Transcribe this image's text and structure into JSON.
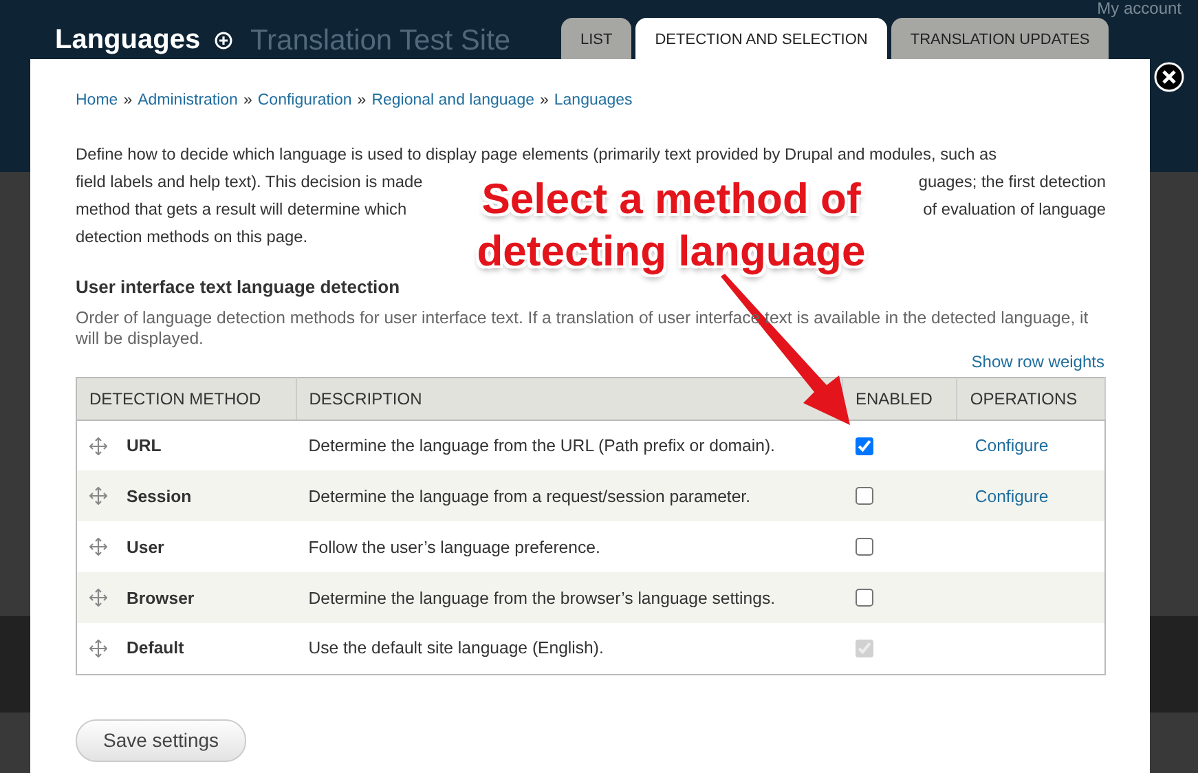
{
  "page": {
    "title": "Languages",
    "site_name": "Translation Test Site",
    "account_link": "My account"
  },
  "tabs": [
    {
      "label": "LIST",
      "selected": false
    },
    {
      "label": "DETECTION AND SELECTION",
      "selected": true
    },
    {
      "label": "TRANSLATION UPDATES",
      "selected": false
    }
  ],
  "breadcrumb": {
    "separator": "»",
    "items": [
      "Home",
      "Administration",
      "Configuration",
      "Regional and language",
      "Languages"
    ]
  },
  "intro": {
    "lines": [
      [
        "Define how to decide which language is used to display page elements (primarily text provided by Drupal and modules, such as"
      ],
      [
        "field labels and help text). This decision is made",
        "guages; the first detection"
      ],
      [
        "method that gets a result will determine which",
        "of evaluation of language"
      ],
      [
        "detection methods on this page."
      ]
    ]
  },
  "section": {
    "title": "User interface text language detection",
    "description": "Order of language detection methods for user interface text. If a translation of user interface text is available in the detected language, it will be displayed."
  },
  "show_row_weights": "Show row weights",
  "table": {
    "columns": [
      "DETECTION METHOD",
      "DESCRIPTION",
      "ENABLED",
      "OPERATIONS"
    ],
    "rows": [
      {
        "method": "URL",
        "description": "Determine the language from the URL (Path prefix or domain).",
        "enabled": true,
        "disabled": false,
        "operation": "Configure"
      },
      {
        "method": "Session",
        "description": "Determine the language from a request/session parameter.",
        "enabled": false,
        "disabled": false,
        "operation": "Configure"
      },
      {
        "method": "User",
        "description": "Follow the user’s language preference.",
        "enabled": false,
        "disabled": false
      },
      {
        "method": "Browser",
        "description": "Determine the language from the browser’s language settings.",
        "enabled": false,
        "disabled": false
      },
      {
        "method": "Default",
        "description": "Use the default site language (English).",
        "enabled": true,
        "disabled": true
      }
    ]
  },
  "save_button": "Save settings",
  "annotation": {
    "text": "Select a method of detecting language"
  }
}
